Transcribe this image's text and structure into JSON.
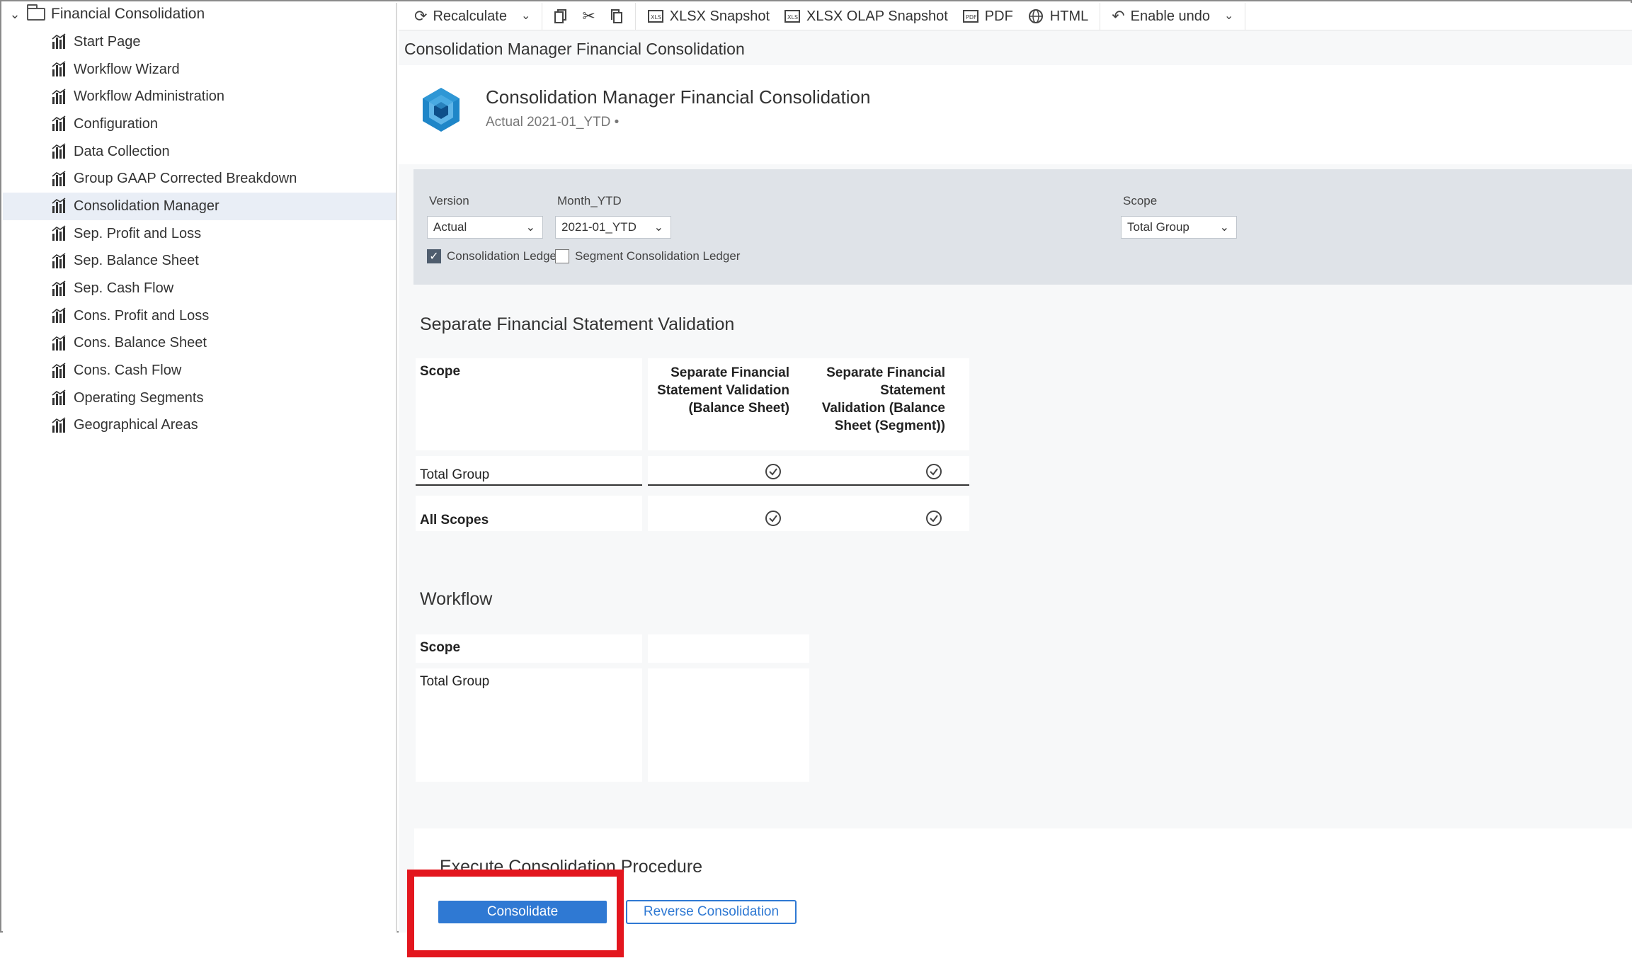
{
  "sidebar": {
    "root_label": "Financial Consolidation",
    "items": [
      {
        "label": "Start Page",
        "selected": false
      },
      {
        "label": "Workflow Wizard",
        "selected": false
      },
      {
        "label": "Workflow Administration",
        "selected": false
      },
      {
        "label": "Configuration",
        "selected": false
      },
      {
        "label": "Data Collection",
        "selected": false
      },
      {
        "label": "Group GAAP Corrected Breakdown",
        "selected": false
      },
      {
        "label": "Consolidation Manager",
        "selected": true
      },
      {
        "label": "Sep. Profit and Loss",
        "selected": false
      },
      {
        "label": "Sep. Balance Sheet",
        "selected": false
      },
      {
        "label": "Sep. Cash Flow",
        "selected": false
      },
      {
        "label": "Cons. Profit and Loss",
        "selected": false
      },
      {
        "label": "Cons. Balance Sheet",
        "selected": false
      },
      {
        "label": "Cons. Cash Flow",
        "selected": false
      },
      {
        "label": "Operating Segments",
        "selected": false
      },
      {
        "label": "Geographical Areas",
        "selected": false
      }
    ]
  },
  "toolbar": {
    "recalculate": "Recalculate",
    "xlsx_snapshot": "XLSX Snapshot",
    "xlsx_olap_snapshot": "XLSX OLAP Snapshot",
    "pdf": "PDF",
    "html": "HTML",
    "enable_undo": "Enable undo"
  },
  "page": {
    "title": "Consolidation Manager Financial Consolidation",
    "app_title": "Consolidation Manager Financial Consolidation",
    "app_subtitle": "Actual 2021-01_YTD •"
  },
  "filters": {
    "version_label": "Version",
    "version_value": "Actual",
    "month_label": "Month_YTD",
    "month_value": "2021-01_YTD",
    "scope_label": "Scope",
    "scope_value": "Total Group",
    "consolidation_ledger_label": "Consolidation Ledger",
    "consolidation_ledger_checked": true,
    "segment_ledger_label": "Segment Consolidation Ledger",
    "segment_ledger_checked": false
  },
  "validation": {
    "title": "Separate Financial Statement Validation",
    "col_scope": "Scope",
    "col_bs": "Separate Financial Statement Validation (Balance Sheet)",
    "col_bs_segment": "Separate Financial Statement Validation (Balance Sheet (Segment))",
    "rows": [
      {
        "scope": "Total Group",
        "bs": "ok",
        "bs_segment": "ok"
      },
      {
        "scope": "All Scopes",
        "bs": "ok",
        "bs_segment": "ok"
      }
    ]
  },
  "workflow": {
    "title": "Workflow",
    "col_scope": "Scope",
    "rows": [
      {
        "scope": "Total Group"
      }
    ]
  },
  "execute": {
    "title": "Execute Consolidation Procedure",
    "consolidate_label": "Consolidate",
    "reverse_label": "Reverse Consolidation"
  },
  "colors": {
    "primary": "#2f79d3",
    "highlight": "#e3161e",
    "filter_panel": "#dfe3e8",
    "selected_row": "#e9eef6"
  },
  "icons": {
    "tree_item": "report-chart-icon",
    "ok": "check-circle-icon"
  }
}
